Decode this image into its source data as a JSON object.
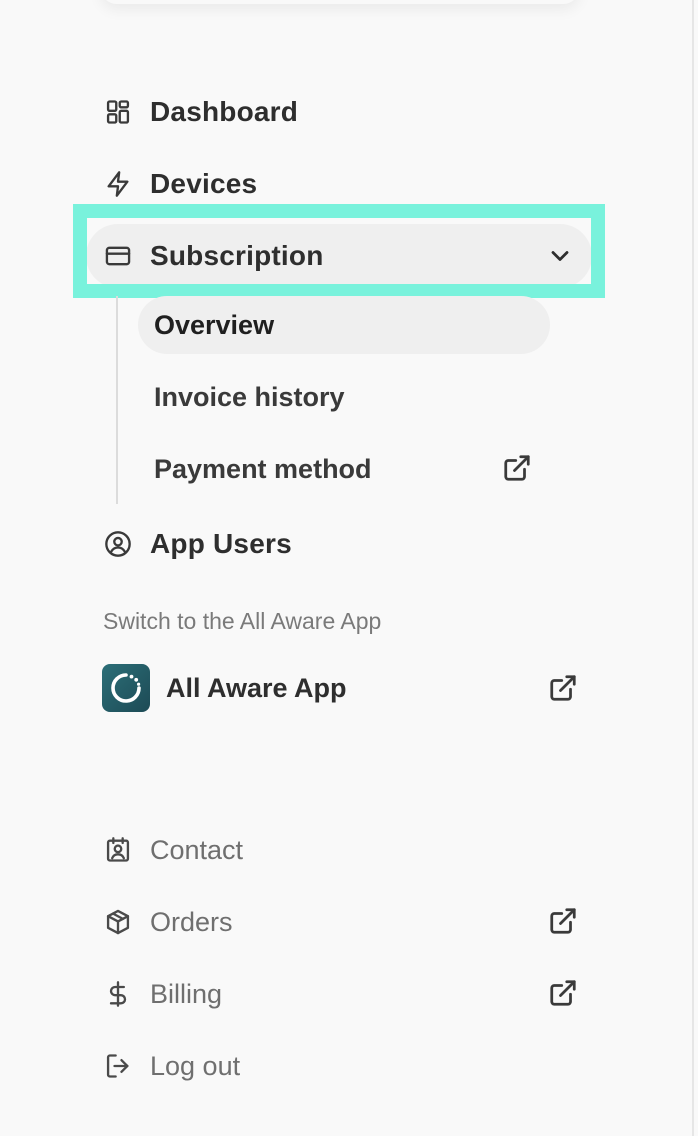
{
  "nav": {
    "items": [
      {
        "label": "Dashboard",
        "icon": "dashboard-icon"
      },
      {
        "label": "Devices",
        "icon": "lightning-icon"
      },
      {
        "label": "Subscription",
        "icon": "credit-card-icon",
        "expanded": true
      }
    ],
    "subscription_sub": [
      {
        "label": "Overview",
        "active": true
      },
      {
        "label": "Invoice history"
      },
      {
        "label": "Payment method",
        "external": true
      }
    ],
    "app_users": {
      "label": "App Users",
      "icon": "user-circle-icon"
    }
  },
  "switch_section": {
    "label": "Switch to the All Aware App",
    "app_name": "All Aware App"
  },
  "bottom": {
    "items": [
      {
        "label": "Contact",
        "icon": "contact-icon"
      },
      {
        "label": "Orders",
        "icon": "box-icon",
        "external": true
      },
      {
        "label": "Billing",
        "icon": "dollar-icon",
        "external": true
      },
      {
        "label": "Log out",
        "icon": "logout-icon"
      }
    ]
  },
  "colors": {
    "highlight": "#79f2dc",
    "active_bg": "#efefef",
    "logo_bg": "#2c6f78"
  }
}
